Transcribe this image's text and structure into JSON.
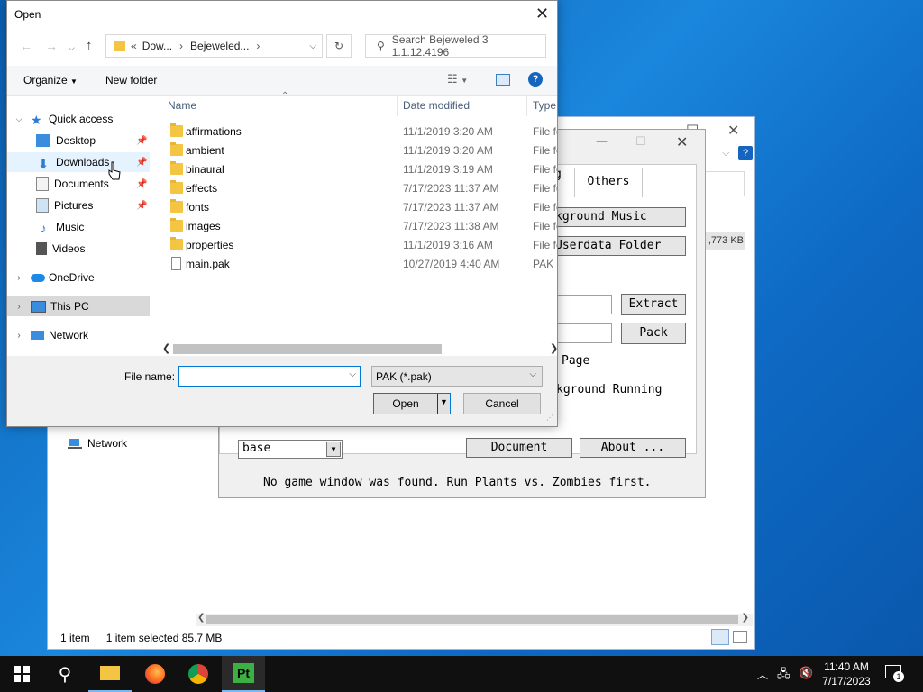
{
  "explorer": {
    "network_label": "Network",
    "status_count": "1 item",
    "status_selected": "1 item selected  85.7 MB",
    "size_fragment": ",773 KB"
  },
  "tool": {
    "tab_others": "Others",
    "tab_fragment": "g",
    "btn_bg_music": "kground Music",
    "btn_userdata": "Userdata Folder",
    "btn_extract": "Extract",
    "btn_pack": "Pack",
    "lbl_page": "Page",
    "lbl_running": "kground Running",
    "select_value": "base",
    "btn_document": "Document",
    "btn_about": "About ...",
    "status": "No game window was found. Run Plants vs. Zombies first."
  },
  "dialog": {
    "title": "Open",
    "breadcrumb": [
      "Dow...",
      "Bejeweled..."
    ],
    "search_placeholder": "Search Bejeweled 3 1.1.12.4196",
    "organize_label": "Organize",
    "new_folder_label": "New folder",
    "columns": {
      "name": "Name",
      "date": "Date modified",
      "type": "Type"
    },
    "nav": [
      {
        "label": "Quick access"
      },
      {
        "label": "Desktop"
      },
      {
        "label": "Downloads"
      },
      {
        "label": "Documents"
      },
      {
        "label": "Pictures"
      },
      {
        "label": "Music"
      },
      {
        "label": "Videos"
      },
      {
        "label": "OneDrive"
      },
      {
        "label": "This PC"
      },
      {
        "label": "Network"
      }
    ],
    "files": [
      {
        "name": "affirmations",
        "date": "11/1/2019 3:20 AM",
        "type": "File fo"
      },
      {
        "name": "ambient",
        "date": "11/1/2019 3:20 AM",
        "type": "File fo"
      },
      {
        "name": "binaural",
        "date": "11/1/2019 3:19 AM",
        "type": "File fo"
      },
      {
        "name": "effects",
        "date": "7/17/2023 11:37 AM",
        "type": "File fo"
      },
      {
        "name": "fonts",
        "date": "7/17/2023 11:37 AM",
        "type": "File fo"
      },
      {
        "name": "images",
        "date": "7/17/2023 11:38 AM",
        "type": "File fo"
      },
      {
        "name": "properties",
        "date": "11/1/2019 3:16 AM",
        "type": "File fo"
      },
      {
        "name": "main.pak",
        "date": "10/27/2019 4:40 AM",
        "type": "PAK F"
      }
    ],
    "file_name_label": "File name:",
    "file_name_value": "",
    "filter_value": "PAK (*.pak)",
    "open_button": "Open",
    "cancel_button": "Cancel"
  },
  "taskbar": {
    "time": "11:40 AM",
    "date": "7/17/2023",
    "notification_count": "1"
  },
  "colors": {
    "accent": "#0078d7",
    "taskbar": "#101010",
    "selection": "#cce8ff"
  }
}
